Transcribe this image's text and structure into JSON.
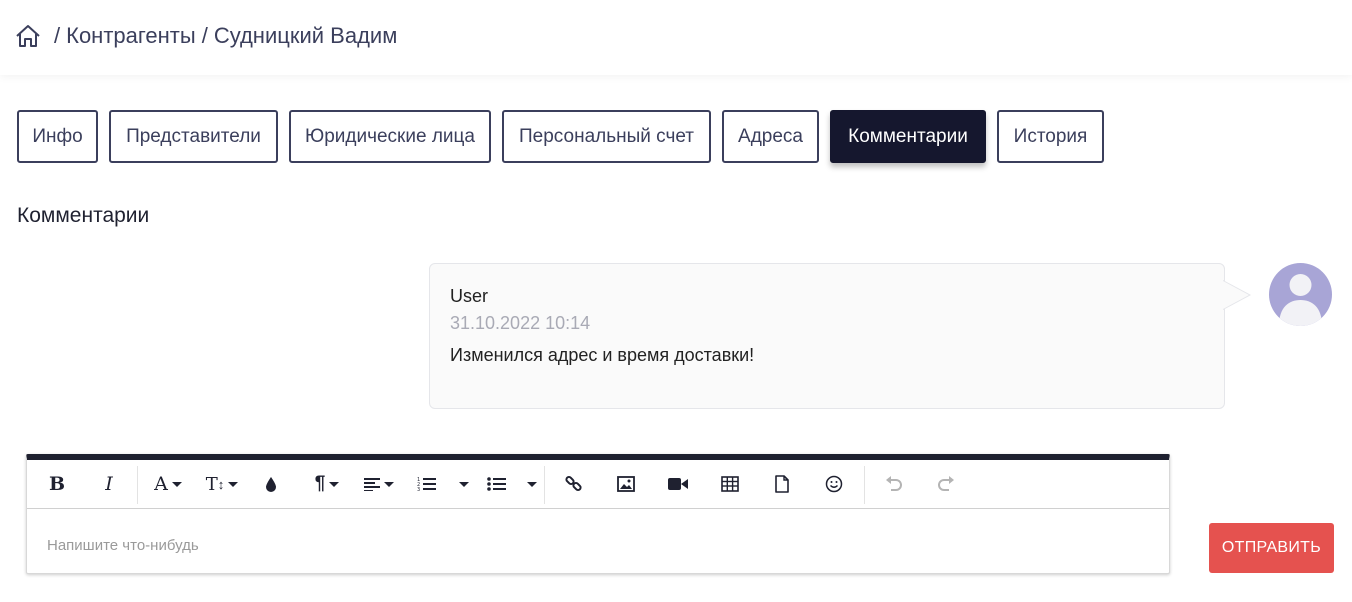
{
  "breadcrumb": {
    "home_icon": "home-icon",
    "separator": "/",
    "items": [
      "Контрагенты",
      "Судницкий Вадим"
    ]
  },
  "tabs": [
    {
      "label": "Инфо",
      "active": false
    },
    {
      "label": "Представители",
      "active": false
    },
    {
      "label": "Юридические лица",
      "active": false
    },
    {
      "label": "Персональный счет",
      "active": false
    },
    {
      "label": "Адреса",
      "active": false
    },
    {
      "label": "Комментарии",
      "active": true
    },
    {
      "label": "История",
      "active": false
    }
  ],
  "section_title": "Комментарии",
  "comments": [
    {
      "user": "User",
      "date": "31.10.2022 10:14",
      "text": "Изменился адрес и время доставки!",
      "avatar_icon": "user-avatar-icon"
    }
  ],
  "editor": {
    "toolbar": [
      "bold-icon",
      "italic-icon",
      "font-color-icon",
      "font-size-icon",
      "highlight-icon",
      "paragraph-icon",
      "align-icon",
      "ordered-list-icon",
      "unordered-list-icon",
      "link-icon",
      "image-icon",
      "video-icon",
      "table-icon",
      "file-icon",
      "emoji-icon",
      "undo-icon",
      "redo-icon"
    ],
    "placeholder": "Напишите что-нибудь"
  },
  "send_button": "ОТПРАВИТЬ",
  "colors": {
    "active_tab": "#15172e",
    "tab_border": "#3b3f5c",
    "send_button": "#e5524f",
    "avatar": "#a8a5d6"
  }
}
